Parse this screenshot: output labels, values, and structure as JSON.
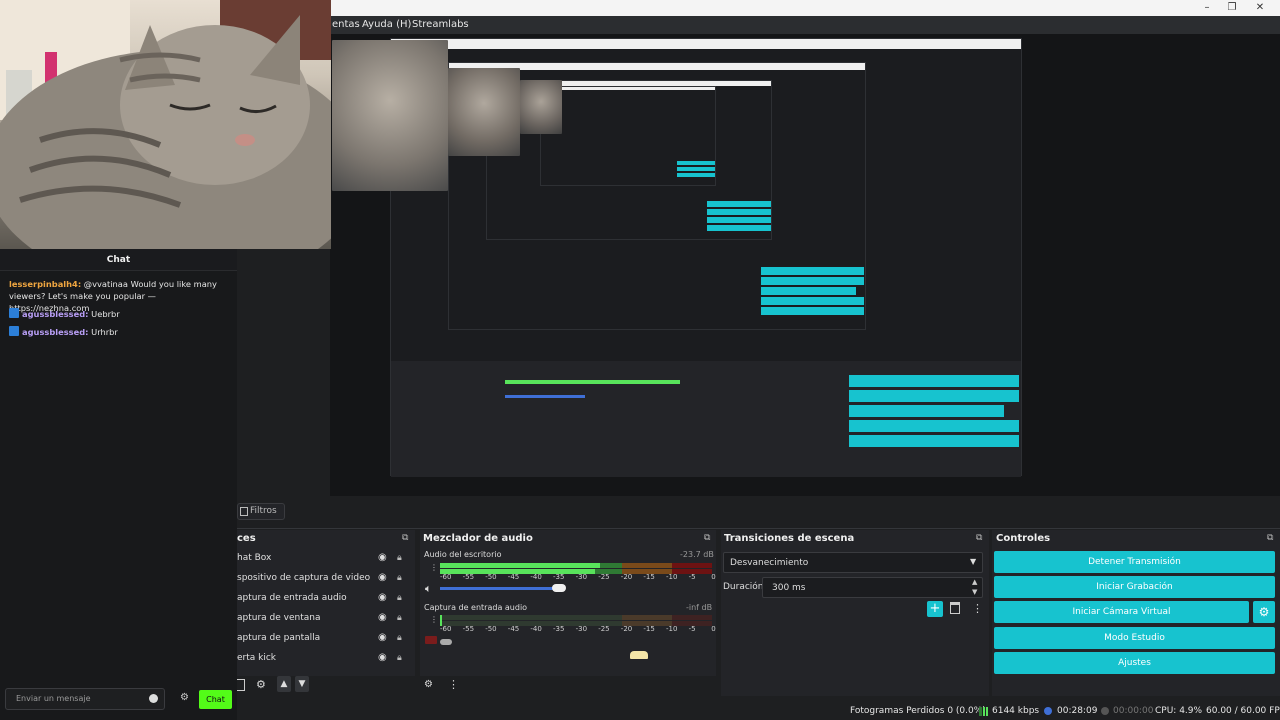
{
  "window": {
    "menu": [
      "entas",
      "Ayuda (H)",
      "Streamlabs"
    ],
    "controls": [
      "–",
      "❐",
      "✕"
    ]
  },
  "filters_tab": "Filtros",
  "sources": {
    "title": "ces",
    "items": [
      "hat Box",
      "spositivo de captura de video",
      "aptura de entrada audio",
      "aptura de ventana",
      "aptura de pantalla",
      "erta kick"
    ]
  },
  "mixer": {
    "title": "Mezclador de audio",
    "channels": [
      {
        "name": "Audio del escritorio",
        "db": "-23.7 dB"
      },
      {
        "name": "Captura de entrada audio",
        "db": "-inf dB"
      }
    ],
    "ticks": [
      "-60",
      "-55",
      "-50",
      "-45",
      "-40",
      "-35",
      "-30",
      "-25",
      "-20",
      "-15",
      "-10",
      "-5",
      "0"
    ]
  },
  "transitions": {
    "title": "Transiciones de escena",
    "selected": "Desvanecimiento",
    "duration_label": "Duración",
    "duration_value": "300 ms"
  },
  "controls": {
    "title": "Controles",
    "stop_stream": "Detener Transmisión",
    "start_recording": "Iniciar Grabación",
    "start_virtual_cam": "Iniciar Cámara Virtual",
    "studio_mode": "Modo Estudio",
    "settings": "Ajustes"
  },
  "status": {
    "dropped": "Fotogramas Perdidos 0 (0.0%)",
    "bitrate": "6144 kbps",
    "stream_time": "00:28:09",
    "rec_time": "00:00:00",
    "cpu": "CPU: 4.9%",
    "fps": "60.00 / 60.00 FPS"
  },
  "chat": {
    "title": "Chat",
    "messages": [
      {
        "user": "lesserpinbalh4:",
        "text": " @vvatinaa Would you like many viewers? Let's make you popular — https://nezhna.com"
      },
      {
        "user": "agussblessed:",
        "text": " Uebrbr"
      },
      {
        "user": "agussblessed:",
        "text": " Urhrbr"
      }
    ],
    "placeholder": "Enviar un mensaje",
    "send": "Chat"
  },
  "colors": {
    "accent": "#17c3cf",
    "kick_green": "#53fc18",
    "meter_green": "#58e35b",
    "meter_dark_green": "#2f7a34"
  }
}
